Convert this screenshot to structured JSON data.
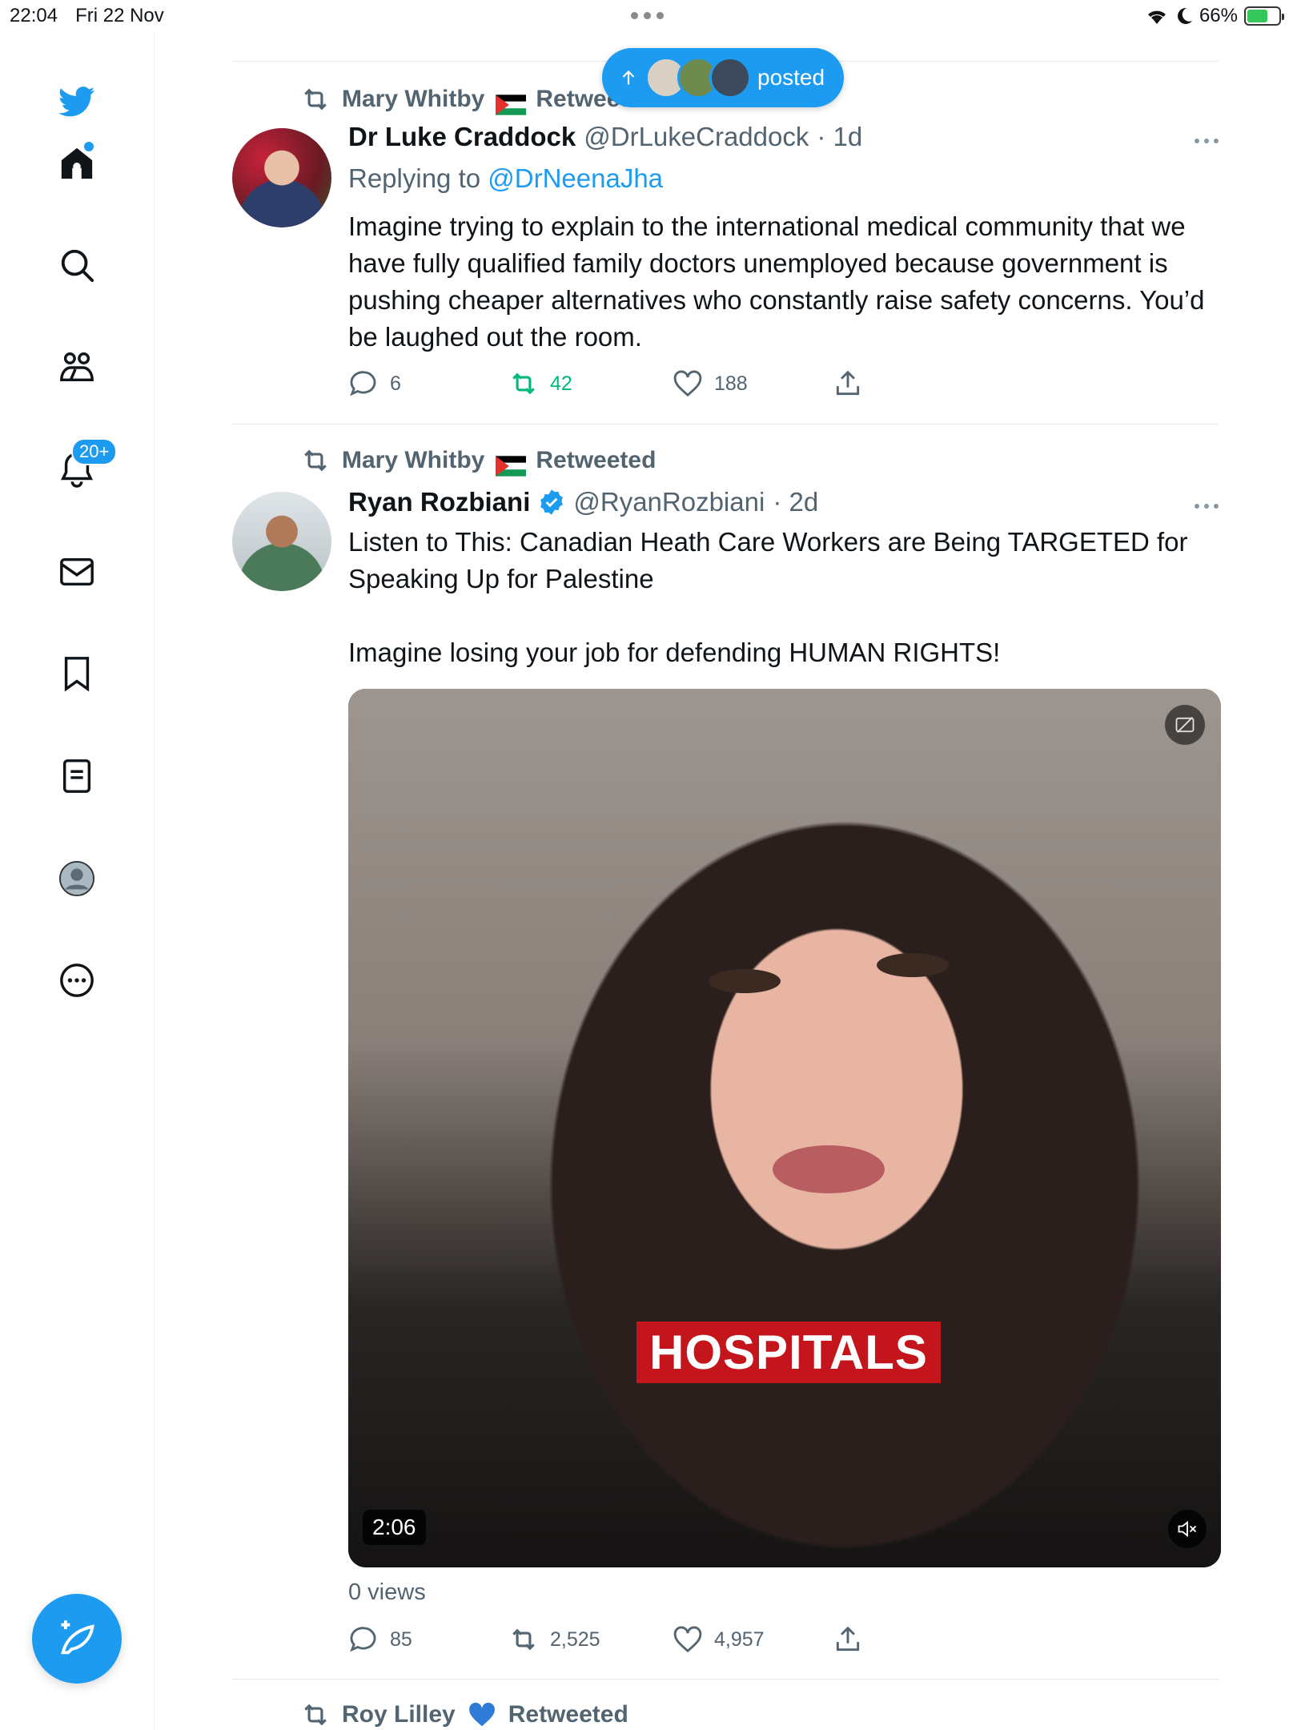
{
  "status_bar": {
    "time": "22:04",
    "date": "Fri 22 Nov",
    "battery": "66%"
  },
  "sidebar": {
    "notifications_badge": "20+"
  },
  "new_posts_pill": {
    "label": "posted"
  },
  "tweets": [
    {
      "retweeted_by": "Mary Whitby",
      "retweet_label": "Retweeted",
      "name": "Dr Luke Craddock",
      "handle": "@DrLukeCraddock",
      "time": "· 1d",
      "replying_prefix": "Replying to ",
      "replying_to": "@DrNeenaJha",
      "text": "Imagine trying to explain to the international medical community that we have fully qualified family doctors unemployed because government is pushing cheaper alternatives who constantly raise safety concerns. You’d be laughed out the room.",
      "replies": "6",
      "retweets": "42",
      "likes": "188"
    },
    {
      "retweeted_by": "Mary Whitby",
      "retweet_label": "Retweeted",
      "name": "Ryan Rozbiani",
      "handle": "@RyanRozbiani",
      "time": "· 2d",
      "text": "Listen to This: Canadian Heath Care Workers are Being TARGETED for Speaking Up for Palestine\n\nImagine losing your job for defending HUMAN RIGHTS!",
      "video_caption": "HOSPITALS",
      "video_duration": "2:06",
      "views": "0 views",
      "replies": "85",
      "retweets": "2,525",
      "likes": "4,957"
    },
    {
      "retweeted_by": "Roy Lilley",
      "retweet_label": "Retweeted"
    }
  ],
  "colors": {
    "accent": "#1d9bf0",
    "retweet_green": "#00ba7c",
    "secondary_text": "#536471"
  },
  "icons": [
    "twitter-logo-icon",
    "home-icon",
    "search-icon",
    "communities-icon",
    "bell-icon",
    "mail-icon",
    "bookmark-icon",
    "lists-icon",
    "profile-icon",
    "more-icon",
    "compose-icon",
    "reply-icon",
    "retweet-icon",
    "like-icon",
    "share-icon",
    "verified-icon",
    "mute-icon",
    "captions-icon"
  ]
}
